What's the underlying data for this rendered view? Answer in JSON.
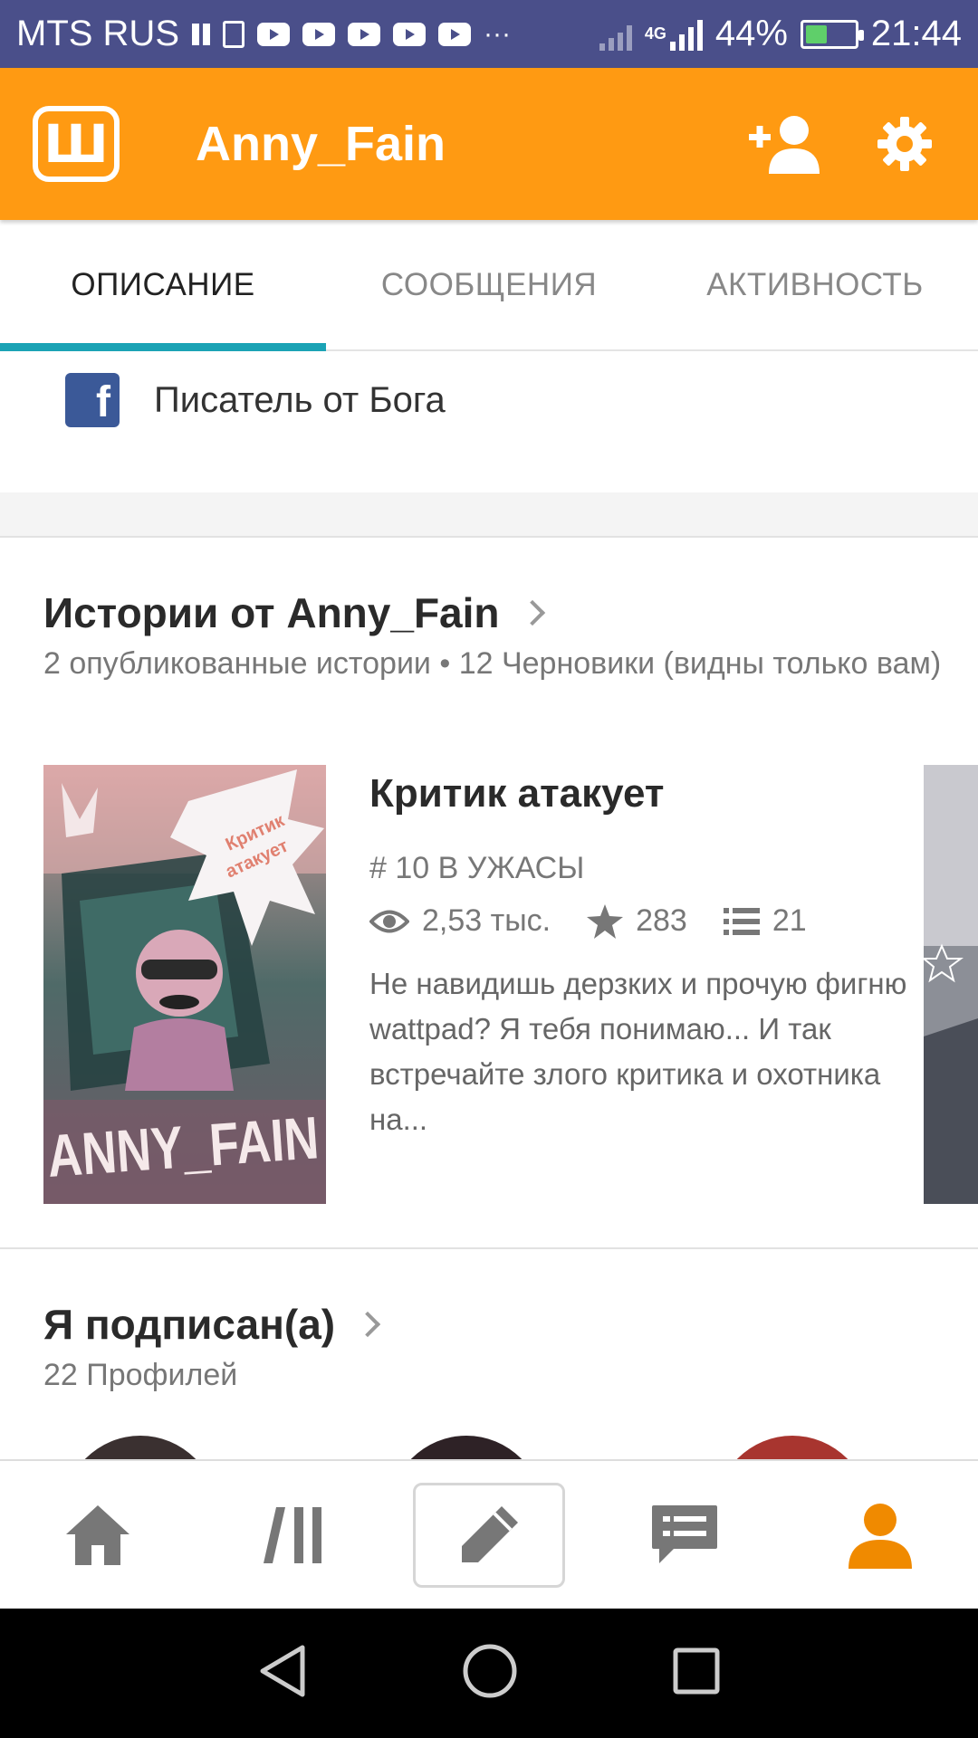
{
  "status_bar": {
    "carrier": "MTS RUS",
    "network": "4G",
    "battery": "44%",
    "time": "21:44",
    "notification_icons": [
      "pause-icon",
      "upload-icon",
      "youtube-icon",
      "youtube-icon",
      "youtube-icon",
      "youtube-icon",
      "youtube-icon",
      "more-dots-icon"
    ],
    "more": "···"
  },
  "app_bar": {
    "logo_letter": "Ш",
    "title": "Anny_Fain",
    "accent_color": "#ff9a12"
  },
  "tabs": [
    {
      "label": "ОПИСАНИЕ",
      "active": true
    },
    {
      "label": "СООБЩЕНИЯ",
      "active": false
    },
    {
      "label": "АКТИВНОСТЬ",
      "active": false
    }
  ],
  "description": {
    "icon": "facebook-icon",
    "text": "Писатель от Бога"
  },
  "stories": {
    "title": "Истории от Anny_Fain",
    "subtitle": "2 опубликованные истории • 12 Черновики (видны только вам)",
    "items": [
      {
        "title": "Критик атакует",
        "rank": "# 10 В УЖАСЫ",
        "views": "2,53 тыс.",
        "votes": "283",
        "parts": "21",
        "description": "Не навидишь дерзких и прочую фигню wattpad? Я тебя понимаю... И так встречайте злого критика и охотника на...",
        "cover_text": "ANNY_FAIN",
        "cover_bubble": "Критик атакует"
      }
    ]
  },
  "following": {
    "title": "Я подписан(а)",
    "subtitle": "22 Профилей"
  },
  "bottom_nav": {
    "items": [
      "home-icon",
      "library-icon",
      "write-icon",
      "messages-icon",
      "profile-icon"
    ],
    "active": "profile-icon",
    "active_color": "#f08a00"
  }
}
